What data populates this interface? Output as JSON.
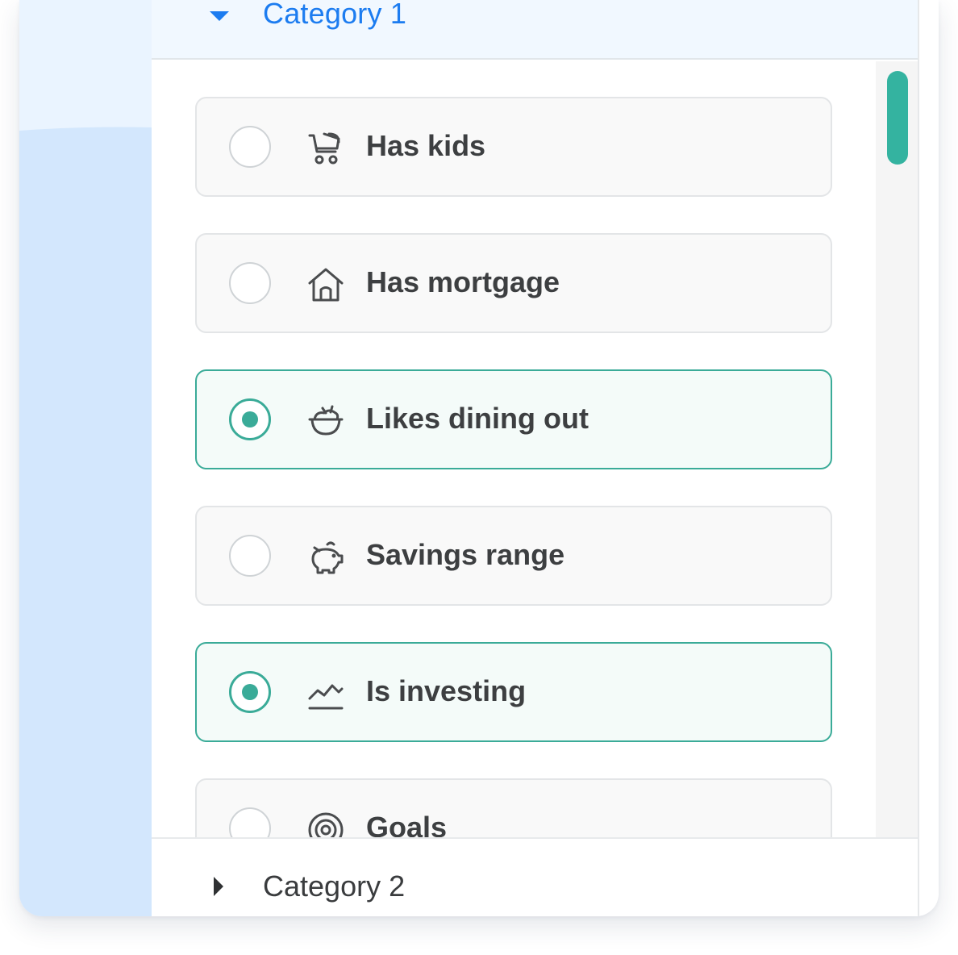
{
  "category1": {
    "title": "Category 1",
    "expanded": true,
    "caret_icon": "caret-down-icon"
  },
  "options": [
    {
      "label": "Has kids",
      "icon": "stroller-icon",
      "selected": false
    },
    {
      "label": "Has mortgage",
      "icon": "house-icon",
      "selected": false
    },
    {
      "label": "Likes dining out",
      "icon": "food-bowl-icon",
      "selected": true
    },
    {
      "label": "Savings range",
      "icon": "piggy-bank-icon",
      "selected": false
    },
    {
      "label": "Is investing",
      "icon": "trend-chart-icon",
      "selected": true
    },
    {
      "label": "Goals",
      "icon": "target-icon",
      "selected": false
    }
  ],
  "category2": {
    "title": "Category 2",
    "expanded": false,
    "caret_icon": "caret-right-icon"
  },
  "colors": {
    "accent": "#3aab98",
    "link_blue": "#1c7cf0",
    "text": "#3d3f41",
    "left_panel": "#d3e7fd"
  }
}
